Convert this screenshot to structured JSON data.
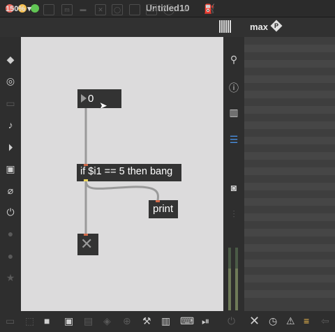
{
  "window": {
    "title": "Untitled10",
    "zoom": "150%"
  },
  "panel": {
    "title": "max"
  },
  "patch": {
    "number_value": "0",
    "if_text": "if $i1 == 5 then bang",
    "print_text": "print"
  },
  "icons": {
    "close_light_color": "#ed6a5e",
    "min_light_color": "#f5bf4f",
    "max_light_color": "#61c554"
  }
}
